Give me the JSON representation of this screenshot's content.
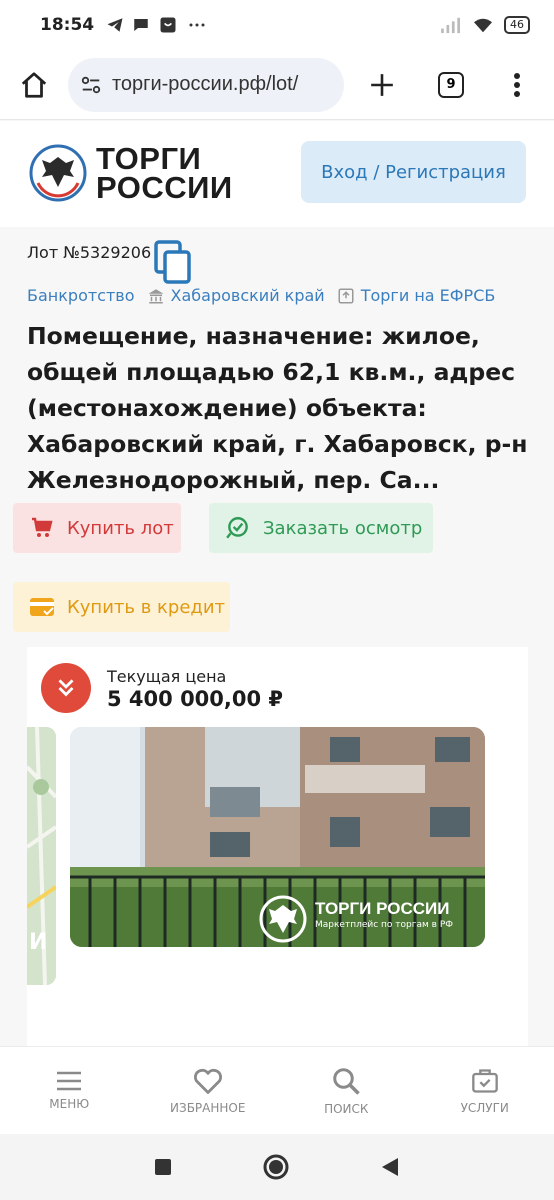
{
  "status_bar": {
    "time": "18:54",
    "battery": "46"
  },
  "browser": {
    "url": "торги-россии.рф/lot/",
    "tab_count": "9"
  },
  "header": {
    "logo_line1": "ТОРГИ",
    "logo_line2": "РОССИИ",
    "login_label": "Вход / Регистрация"
  },
  "lot": {
    "number": "Лот №5329206",
    "breadcrumbs": [
      "Банкротство",
      "Хабаровский край",
      "Торги на ЕФРСБ"
    ],
    "title": "Помещение, назначение: жилое, общей площадью 62,1 кв.м., адрес (местонахождение) объекта: Хабаровский край, г. Хабаровск, р-н Железнодорожный, пер. Са..."
  },
  "actions": {
    "buy": "Купить лот",
    "inspect": "Заказать осмотр",
    "credit": "Купить в кредит"
  },
  "price": {
    "label": "Текущая цена",
    "value": "5 400 000,00 ₽"
  },
  "photo_watermark": {
    "brand": "ТОРГИ РОССИИ",
    "tagline": "Маркетплейс по торгам в РФ"
  },
  "bottom_nav": {
    "menu": "МЕНЮ",
    "favorites": "ИЗБРАННОЕ",
    "search": "ПОИСК",
    "services": "УСЛУГИ"
  },
  "colors": {
    "accent_blue": "#2b78b8",
    "buy_red": "#d23a3a",
    "inspect_green": "#2e9a55",
    "credit_orange": "#e09a12",
    "price_badge": "#e04a3a"
  }
}
